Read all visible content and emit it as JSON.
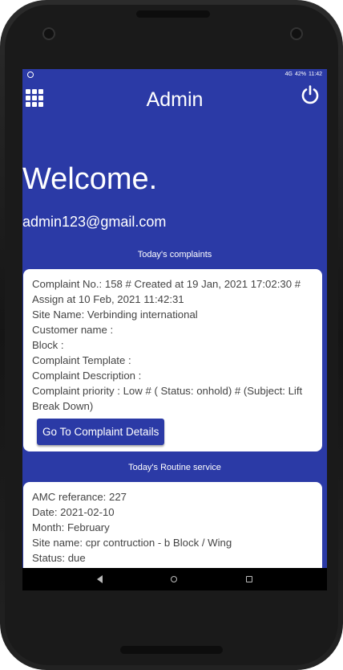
{
  "status_bar": {
    "battery": "42%",
    "time": "11:42",
    "network": "4G"
  },
  "app_bar": {
    "title": "Admin"
  },
  "welcome": {
    "heading": "Welcome.",
    "email": "admin123@gmail.com"
  },
  "complaints": {
    "section_title": "Today's complaints",
    "lines": [
      "Complaint No.: 158 # Created at 19 Jan, 2021 17:02:30 # Assign at 10 Feb, 2021 11:42:31",
      "Site Name: Verbinding international",
      "Customer name :",
      "Block :",
      "Complaint Template :",
      "Complaint Description :",
      "Complaint priority : Low # ( Status: onhold) # (Subject: Lift Break Down)"
    ],
    "button_label": "Go To Complaint Details"
  },
  "routine": {
    "section_title": "Today's Routine service",
    "lines": [
      "AMC referance: 227",
      "Date: 2021-02-10",
      "Month: February",
      "Site name: cpr contruction - b Block / Wing",
      "Status: due"
    ]
  },
  "colors": {
    "primary": "#2b3aa6",
    "card": "#ffffff",
    "text": "#444444"
  },
  "icons": {
    "menu": "grid-menu-icon",
    "power": "power-icon"
  }
}
